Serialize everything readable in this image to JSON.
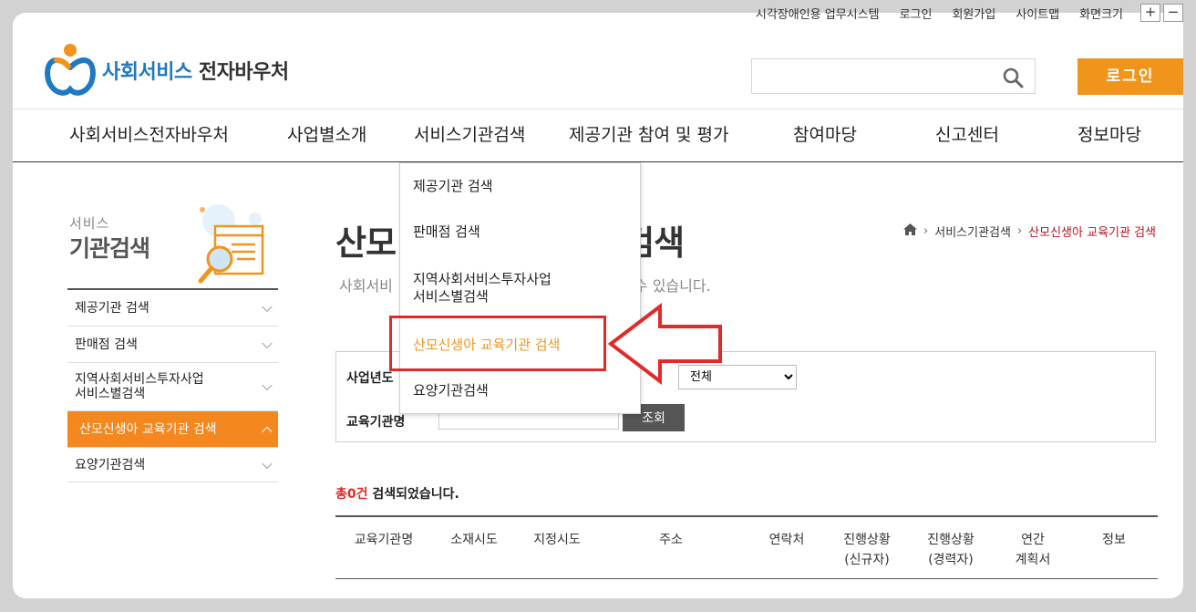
{
  "util": {
    "items": [
      "시각장애인용 업무시스템",
      "로그인",
      "회원가입",
      "사이트맵",
      "화면크기"
    ],
    "zoom_in": "+",
    "zoom_out": "−"
  },
  "header": {
    "logo_blue": "사회서비스",
    "logo_dark": "전자바우처",
    "search_placeholder": "",
    "login_label": "로그인"
  },
  "gnb": {
    "items": [
      "사회서비스전자바우처",
      "사업별소개",
      "서비스기관검색",
      "제공기관 참여 및 평가",
      "참여마당",
      "신고센터",
      "정보마당"
    ]
  },
  "dropdown": {
    "items": [
      "제공기관 검색",
      "판매점 검색",
      "지역사회서비스투자사업",
      "서비스별검색",
      "산모신생아 교육기관 검색",
      "요양기관검색"
    ]
  },
  "sidebar": {
    "title_small": "서비스",
    "title_main": "기관검색",
    "items": [
      {
        "label": "제공기관 검색"
      },
      {
        "label": "판매점 검색"
      },
      {
        "label": "지역사회서비스투자사업",
        "label2": "서비스별검색"
      },
      {
        "label": "산모신생아 교육기관 검색"
      },
      {
        "label": "요양기관검색"
      }
    ]
  },
  "content": {
    "title_left": "산모",
    "title_right": "검색",
    "desc_left": "사회서비",
    "desc_right": "수 있습니다.",
    "breadcrumb": [
      "서비스기관검색",
      "산모신생아 교육기관 검색"
    ]
  },
  "search_form": {
    "year_label": "사업년도",
    "region_value": "전체",
    "name_label": "교육기관명",
    "name_value": "",
    "submit_label": "조회"
  },
  "results": {
    "count_prefix": "총0건",
    "count_suffix": "검색되었습니다."
  },
  "table": {
    "columns": [
      "교육기관명",
      "소재시도",
      "지정시도",
      "주소",
      "연락처",
      "진행상황",
      "진행상황",
      "연간",
      "정보"
    ],
    "columns_line2": [
      "",
      "",
      "",
      "",
      "",
      "(신규자)",
      "(경력자)",
      "계획서",
      ""
    ]
  },
  "colors": {
    "accent_orange": "#f0941c",
    "brand_blue": "#1f79c1",
    "highlight_red": "#e12a2a",
    "breadcrumb_current": "#c0121f"
  }
}
